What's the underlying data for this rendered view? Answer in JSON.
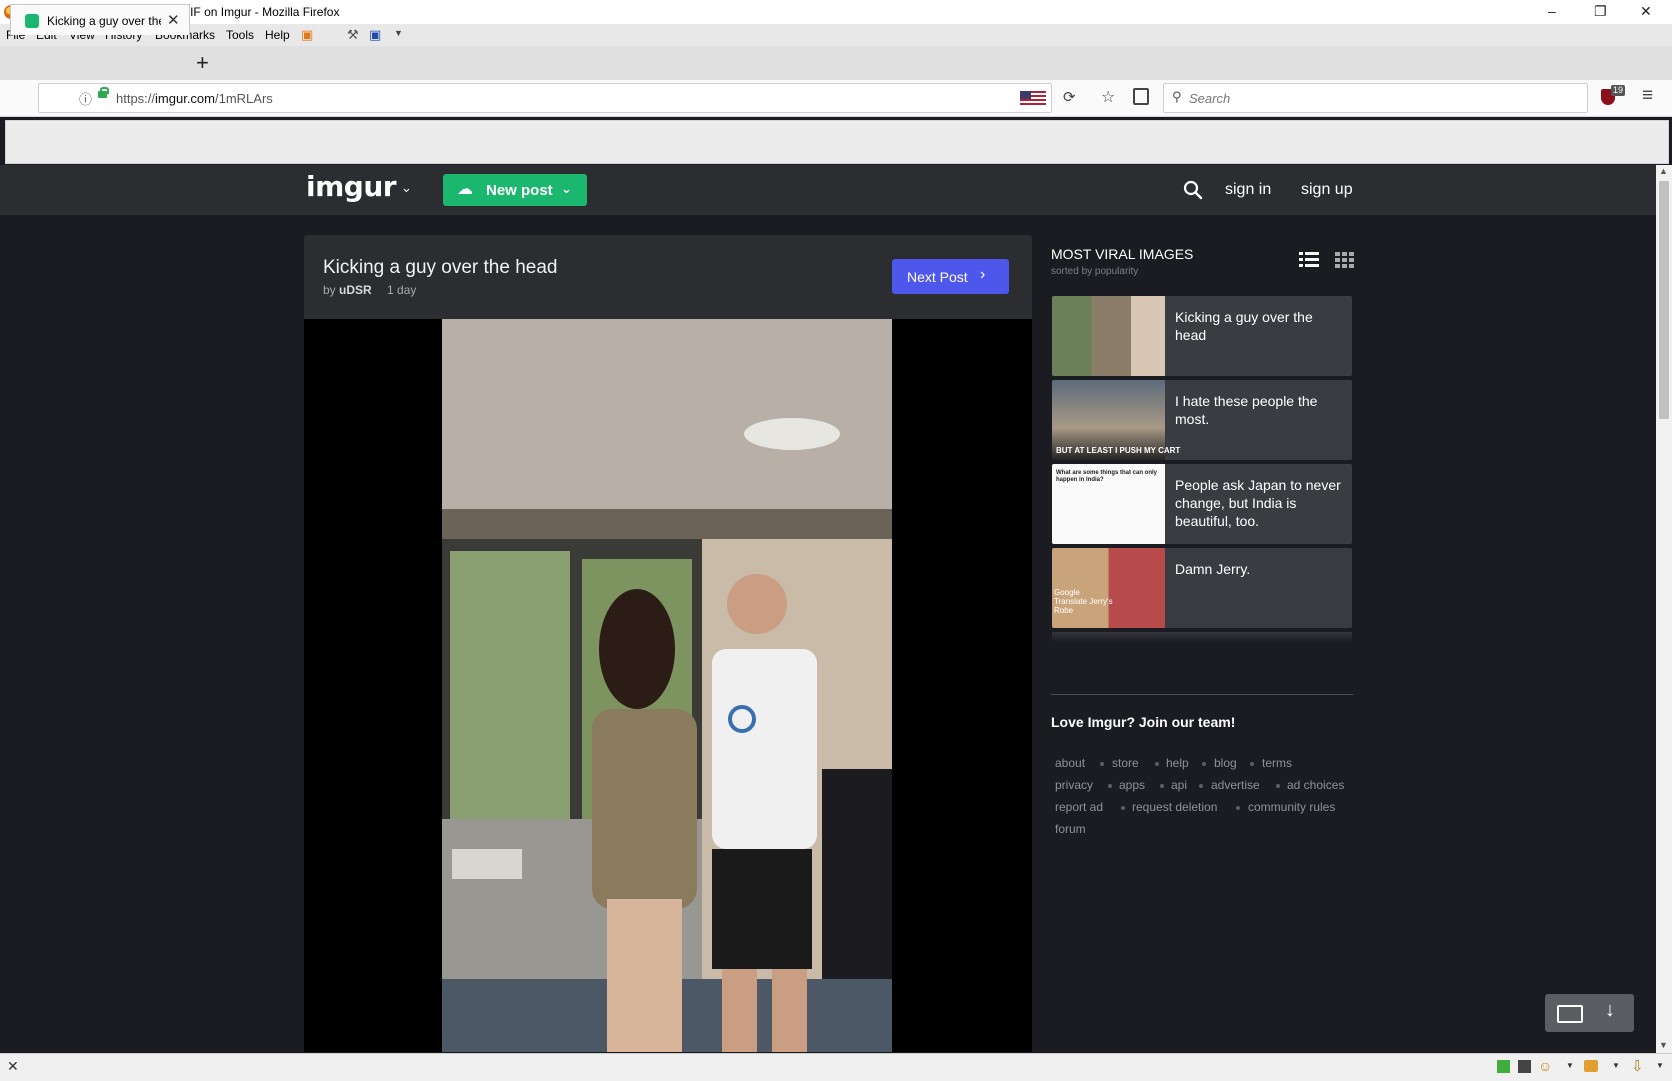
{
  "window": {
    "title": "Kicking a guy over the head - GIF on Imgur - Mozilla Firefox",
    "controls": [
      "–",
      "❐",
      "✕"
    ]
  },
  "menu": [
    "File",
    "Edit",
    "View",
    "History",
    "Bookmarks",
    "Tools",
    "Help"
  ],
  "tab": {
    "title": "Kicking a guy over the head - GIF on Imgur",
    "close": "✕"
  },
  "newtab_label": "+",
  "navbar": {
    "url_scheme": "https://",
    "url_host": "imgur.com",
    "url_path": "/1mRLArs",
    "search_placeholder": "Search",
    "ublock_count": "19"
  },
  "imgur": {
    "logo": "imgur",
    "new_post": "New post",
    "sign_in": "sign in",
    "sign_up": "sign up",
    "accent": "#1bb76e",
    "next_accent": "#4d57ec"
  },
  "post": {
    "title": "Kicking a guy over the head",
    "by_label": "by",
    "author": "uDSR",
    "age": "1 day",
    "next_label": "Next Post"
  },
  "sidebar": {
    "heading": "MOST VIRAL IMAGES",
    "subheading": "sorted by popularity",
    "items": [
      {
        "title": "Kicking a guy over the head"
      },
      {
        "title": "I hate these people the most.",
        "caption": "BUT AT LEAST I PUSH MY CART"
      },
      {
        "title": "People ask Japan to never change, but India is beautiful, too.",
        "caption": "What are some things that can only happen in India?"
      },
      {
        "title": "Damn Jerry.",
        "caption": "Google Translate Jerry's Robe"
      }
    ],
    "join": "Love Imgur? Join our team!",
    "links": [
      "about",
      "store",
      "help",
      "blog",
      "terms",
      "privacy",
      "apps",
      "api",
      "advertise",
      "ad choices",
      "report ad",
      "request deletion",
      "community rules",
      "forum"
    ]
  },
  "statusbar": {
    "close": "✕"
  }
}
